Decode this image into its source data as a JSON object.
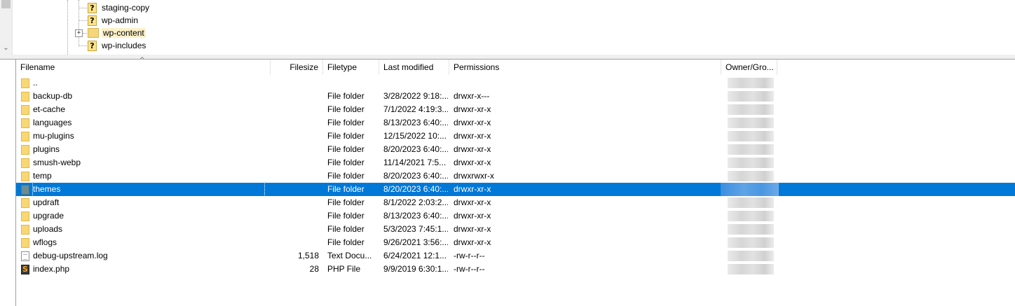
{
  "tree": {
    "nodes": [
      {
        "label": "staging-copy",
        "icon": "question-folder-icon",
        "highlighted": false
      },
      {
        "label": "wp-admin",
        "icon": "question-folder-icon",
        "highlighted": false
      },
      {
        "label": "wp-content",
        "icon": "folder-icon",
        "highlighted": true,
        "expandable": true
      },
      {
        "label": "wp-includes",
        "icon": "question-folder-icon",
        "highlighted": false
      }
    ]
  },
  "list": {
    "columns": {
      "filename": "Filename",
      "filesize": "Filesize",
      "filetype": "Filetype",
      "modified": "Last modified",
      "permissions": "Permissions",
      "owner": "Owner/Gro..."
    },
    "rows": [
      {
        "name": "..",
        "size": "",
        "type": "",
        "modified": "",
        "perms": "",
        "icon": "folder"
      },
      {
        "name": "backup-db",
        "size": "",
        "type": "File folder",
        "modified": "3/28/2022 9:18:...",
        "perms": "drwxr-x---",
        "icon": "folder"
      },
      {
        "name": "et-cache",
        "size": "",
        "type": "File folder",
        "modified": "7/1/2022 4:19:3...",
        "perms": "drwxr-xr-x",
        "icon": "folder"
      },
      {
        "name": "languages",
        "size": "",
        "type": "File folder",
        "modified": "8/13/2023 6:40:...",
        "perms": "drwxr-xr-x",
        "icon": "folder"
      },
      {
        "name": "mu-plugins",
        "size": "",
        "type": "File folder",
        "modified": "12/15/2022 10:...",
        "perms": "drwxr-xr-x",
        "icon": "folder"
      },
      {
        "name": "plugins",
        "size": "",
        "type": "File folder",
        "modified": "8/20/2023 6:40:...",
        "perms": "drwxr-xr-x",
        "icon": "folder"
      },
      {
        "name": "smush-webp",
        "size": "",
        "type": "File folder",
        "modified": "11/14/2021 7:5...",
        "perms": "drwxr-xr-x",
        "icon": "folder"
      },
      {
        "name": "temp",
        "size": "",
        "type": "File folder",
        "modified": "8/20/2023 6:40:...",
        "perms": "drwxrwxr-x",
        "icon": "folder"
      },
      {
        "name": "themes",
        "size": "",
        "type": "File folder",
        "modified": "8/20/2023 6:40:...",
        "perms": "drwxr-xr-x",
        "icon": "folder",
        "selected": true
      },
      {
        "name": "updraft",
        "size": "",
        "type": "File folder",
        "modified": "8/1/2022 2:03:2...",
        "perms": "drwxr-xr-x",
        "icon": "folder"
      },
      {
        "name": "upgrade",
        "size": "",
        "type": "File folder",
        "modified": "8/13/2023 6:40:...",
        "perms": "drwxr-xr-x",
        "icon": "folder"
      },
      {
        "name": "uploads",
        "size": "",
        "type": "File folder",
        "modified": "5/3/2023 7:45:1...",
        "perms": "drwxr-xr-x",
        "icon": "folder"
      },
      {
        "name": "wflogs",
        "size": "",
        "type": "File folder",
        "modified": "9/26/2021 3:56:...",
        "perms": "drwxr-xr-x",
        "icon": "folder"
      },
      {
        "name": "debug-upstream.log",
        "size": "1,518",
        "type": "Text Docu...",
        "modified": "6/24/2021 12:1...",
        "perms": "-rw-r--r--",
        "icon": "file"
      },
      {
        "name": "index.php",
        "size": "28",
        "type": "PHP File",
        "modified": "9/9/2019 6:30:1...",
        "perms": "-rw-r--r--",
        "icon": "php"
      }
    ]
  },
  "colors": {
    "selection": "#0078d7",
    "folder": "#f8d775"
  }
}
